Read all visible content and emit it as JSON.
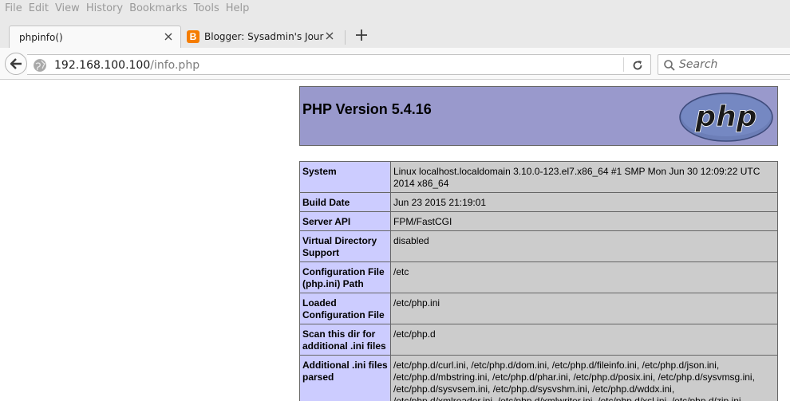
{
  "menubar": [
    "File",
    "Edit",
    "View",
    "History",
    "Bookmarks",
    "Tools",
    "Help"
  ],
  "tabs": [
    {
      "title": "phpinfo()"
    },
    {
      "title": "Blogger: Sysadmin's Journ..."
    }
  ],
  "favicon_letter": "B",
  "address": {
    "host": "192.168.100.100",
    "path": "/info.php"
  },
  "search": {
    "placeholder": "Search"
  },
  "php": {
    "title": "PHP Version 5.4.16",
    "logo_text": "php",
    "rows": [
      {
        "key": "System",
        "value": "Linux localhost.localdomain 3.10.0-123.el7.x86_64 #1 SMP Mon Jun 30 12:09:22 UTC 2014 x86_64"
      },
      {
        "key": "Build Date",
        "value": "Jun 23 2015 21:19:01"
      },
      {
        "key": "Server API",
        "value": "FPM/FastCGI"
      },
      {
        "key": "Virtual Directory Support",
        "value": "disabled"
      },
      {
        "key": "Configuration File (php.ini) Path",
        "value": "/etc"
      },
      {
        "key": "Loaded Configuration File",
        "value": "/etc/php.ini"
      },
      {
        "key": "Scan this dir for additional .ini files",
        "value": "/etc/php.d"
      },
      {
        "key": "Additional .ini files parsed",
        "value": "/etc/php.d/curl.ini, /etc/php.d/dom.ini, /etc/php.d/fileinfo.ini, /etc/php.d/json.ini, /etc/php.d/mbstring.ini, /etc/php.d/phar.ini, /etc/php.d/posix.ini, /etc/php.d/sysvmsg.ini, /etc/php.d/sysvsem.ini, /etc/php.d/sysvshm.ini, /etc/php.d/wddx.ini, /etc/php.d/xmlreader.ini, /etc/php.d/xmlwriter.ini, /etc/php.d/xsl.ini, /etc/php.d/zip.ini"
      }
    ]
  }
}
